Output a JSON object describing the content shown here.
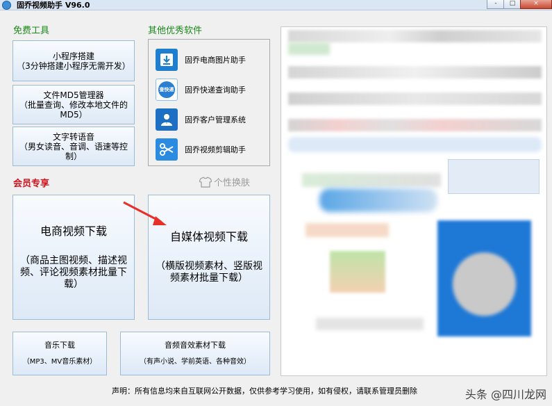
{
  "window": {
    "title": "固乔视频助手 V96.0",
    "min": "-",
    "max": "□",
    "close": "×"
  },
  "free_tools": {
    "title": "免费工具",
    "items": [
      {
        "line1": "小程序搭建",
        "line2": "（3分钟搭建小程序无需开发）"
      },
      {
        "line1": "文件MD5管理器",
        "line2": "（批量查询、修改本地文件的MD5）"
      },
      {
        "line1": "文字转语音",
        "line2": "（男女读音、音调、语速等控制）"
      }
    ]
  },
  "other_software": {
    "title": "其他优秀软件",
    "items": [
      {
        "label": "固乔电商图片助手",
        "icon": "download-icon"
      },
      {
        "label": "固乔快递查询助手",
        "icon": "express-search-icon",
        "badge": "查快递"
      },
      {
        "label": "固乔客户管理系统",
        "icon": "customer-icon"
      },
      {
        "label": "固乔视频剪辑助手",
        "icon": "scissors-icon"
      }
    ]
  },
  "vip": {
    "title": "会员专享"
  },
  "skin": {
    "label": "个性换肤",
    "icon": "tshirt-icon"
  },
  "big_buttons": [
    {
      "line1": "电商视频下载",
      "line2": "（商品主图视频、描述视频、评论视频素材批量下载）"
    },
    {
      "line1": "自媒体视频下载",
      "line2": "（横版视频素材、竖版视频素材批量下载）"
    }
  ],
  "small_buttons": [
    {
      "line1": "音乐下载",
      "line2": "（MP3、MV音乐素材）"
    },
    {
      "line1": "音频音效素材下载",
      "line2": "（有声小说、学前英语、各种音效）"
    }
  ],
  "footer": "声明：所有信息均来自互联网公开数据，仅供参考学习使用，如有侵权，请联系管理员删除",
  "watermark": "头条 @四川龙网",
  "colors": {
    "accent_green": "#1a8a1a",
    "vip_red": "#d0141d",
    "button_border": "#9bbbd9",
    "arrow_red": "#e8302a"
  }
}
